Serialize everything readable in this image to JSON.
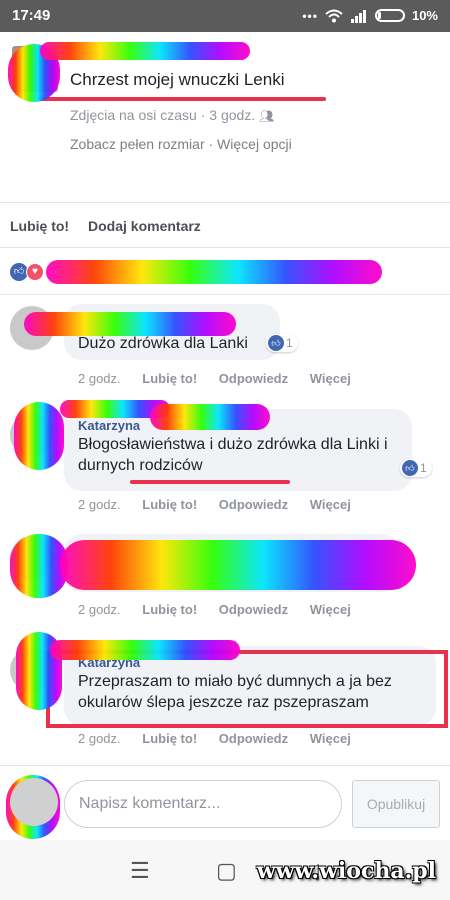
{
  "status_bar": {
    "time": "17:49",
    "battery": "10%"
  },
  "post": {
    "title": "Chrzest mojej wnuczki Lenki",
    "meta": "Zdjęcia na osi czasu · 3 godz.",
    "links": "Zobacz pełen rozmiar · Więcej opcji"
  },
  "actions": {
    "like": "Lubię to!",
    "comment": "Dodaj komentarz"
  },
  "comments": [
    {
      "text": "Dużo zdrówka dla Lanki",
      "likes": "1",
      "time": "2 godz.",
      "like": "Lubię to!",
      "reply": "Odpowiedz",
      "more": "Więcej"
    },
    {
      "author": "Katarzyna",
      "text": "Błogosławieństwa i dużo zdrówka dla Linki i durnych rodziców",
      "likes": "1",
      "time": "2 godz.",
      "like": "Lubię to!",
      "reply": "Odpowiedz",
      "more": "Więcej"
    },
    {
      "time": "2 godz.",
      "like": "Lubię to!",
      "reply": "Odpowiedz",
      "more": "Więcej"
    },
    {
      "author": "Katarzyna",
      "text": "Przepraszam to miało być dumnych a ja bez okularów ślepa jeszcze raz pszepraszam",
      "time": "2 godz.",
      "like": "Lubię to!",
      "reply": "Odpowiedz",
      "more": "Więcej"
    }
  ],
  "composer": {
    "placeholder": "Napisz komentarz...",
    "publish": "Opublikuj"
  },
  "watermark": "www.wiocha.pl",
  "colors": {
    "accent": "#4267b2",
    "highlight": "#e8324d"
  },
  "icons": [
    "wifi-icon",
    "signal-icon",
    "battery-icon",
    "like-icon",
    "love-icon",
    "friends-icon",
    "menu-icon",
    "home-icon",
    "back-icon"
  ]
}
